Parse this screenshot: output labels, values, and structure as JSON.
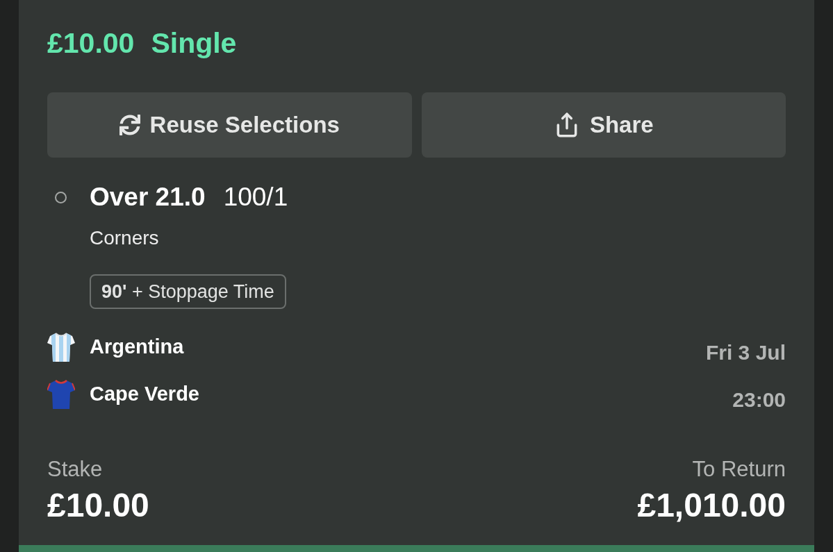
{
  "bet": {
    "stake_amount": "£10.00",
    "bet_type": "Single"
  },
  "actions": [
    {
      "kind": "reuse",
      "label": "Reuse Selections"
    },
    {
      "kind": "share",
      "label": "Share"
    }
  ],
  "selection": {
    "name": "Over 21.0",
    "odds": "100/1",
    "market": "Corners",
    "period": "**90'** + Stoppage Time"
  },
  "event": {
    "teams": [
      {
        "name": "Argentina",
        "kind": "striped",
        "color": "#a9d3f0"
      },
      {
        "name": "Cape Verde",
        "kind": "solid",
        "color": "#1f45b0"
      }
    ],
    "date": "Fri 3 Jul",
    "time": "23:00"
  },
  "summary": {
    "stake_label": "Stake",
    "stake": "£10.00",
    "return_label": "To Return",
    "return": "£1,010.00"
  }
}
